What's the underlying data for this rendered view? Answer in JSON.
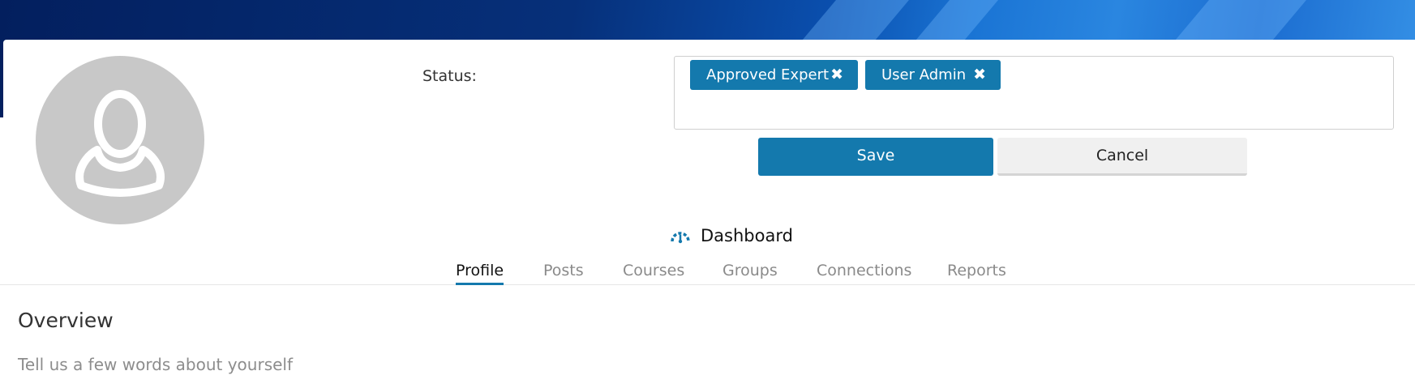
{
  "colors": {
    "accent": "#1479ad",
    "avatar_bg": "#c8c8c8",
    "banner_dark": "#031f5e",
    "banner_light": "#2a86e0"
  },
  "profile": {
    "avatar_icon": "user-silhouette-icon"
  },
  "status": {
    "label": "Status:",
    "tags": [
      {
        "label": "Approved Expert",
        "remove": "✖"
      },
      {
        "label": "User Admin",
        "remove": "✖"
      }
    ]
  },
  "actions": {
    "save_label": "Save",
    "cancel_label": "Cancel"
  },
  "dashboard": {
    "icon": "gauge-icon",
    "label": "Dashboard"
  },
  "tabs": [
    {
      "label": "Profile",
      "active": true
    },
    {
      "label": "Posts",
      "active": false
    },
    {
      "label": "Courses",
      "active": false
    },
    {
      "label": "Groups",
      "active": false
    },
    {
      "label": "Connections",
      "active": false
    },
    {
      "label": "Reports",
      "active": false
    }
  ],
  "overview": {
    "title": "Overview",
    "placeholder": "Tell us a few words about yourself"
  }
}
